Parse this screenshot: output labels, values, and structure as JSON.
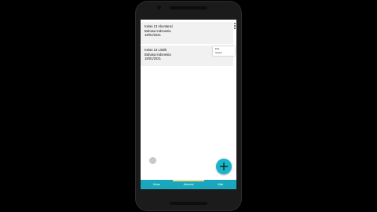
{
  "classes": [
    {
      "name": "Kelas 13 Akuntansi",
      "subject": "Bahasa Indonesia",
      "date": "18/01/2021"
    },
    {
      "name": "Kelas 13 Listrik",
      "subject": "Bahasa Indonesia",
      "date": "18/01/2021"
    }
  ],
  "popup_menu": {
    "items": [
      "Edit",
      "Hapus"
    ]
  },
  "bottom_nav": {
    "items": [
      "Kelas",
      "Absensi",
      "Nilai"
    ],
    "active": "Absensi"
  },
  "fab": {
    "icon": "plus-icon"
  },
  "colors": {
    "accent": "#1aa7bd",
    "fab": "#19b5c9",
    "active_indicator": "#f2e28a",
    "card": "#f1f1f1"
  }
}
